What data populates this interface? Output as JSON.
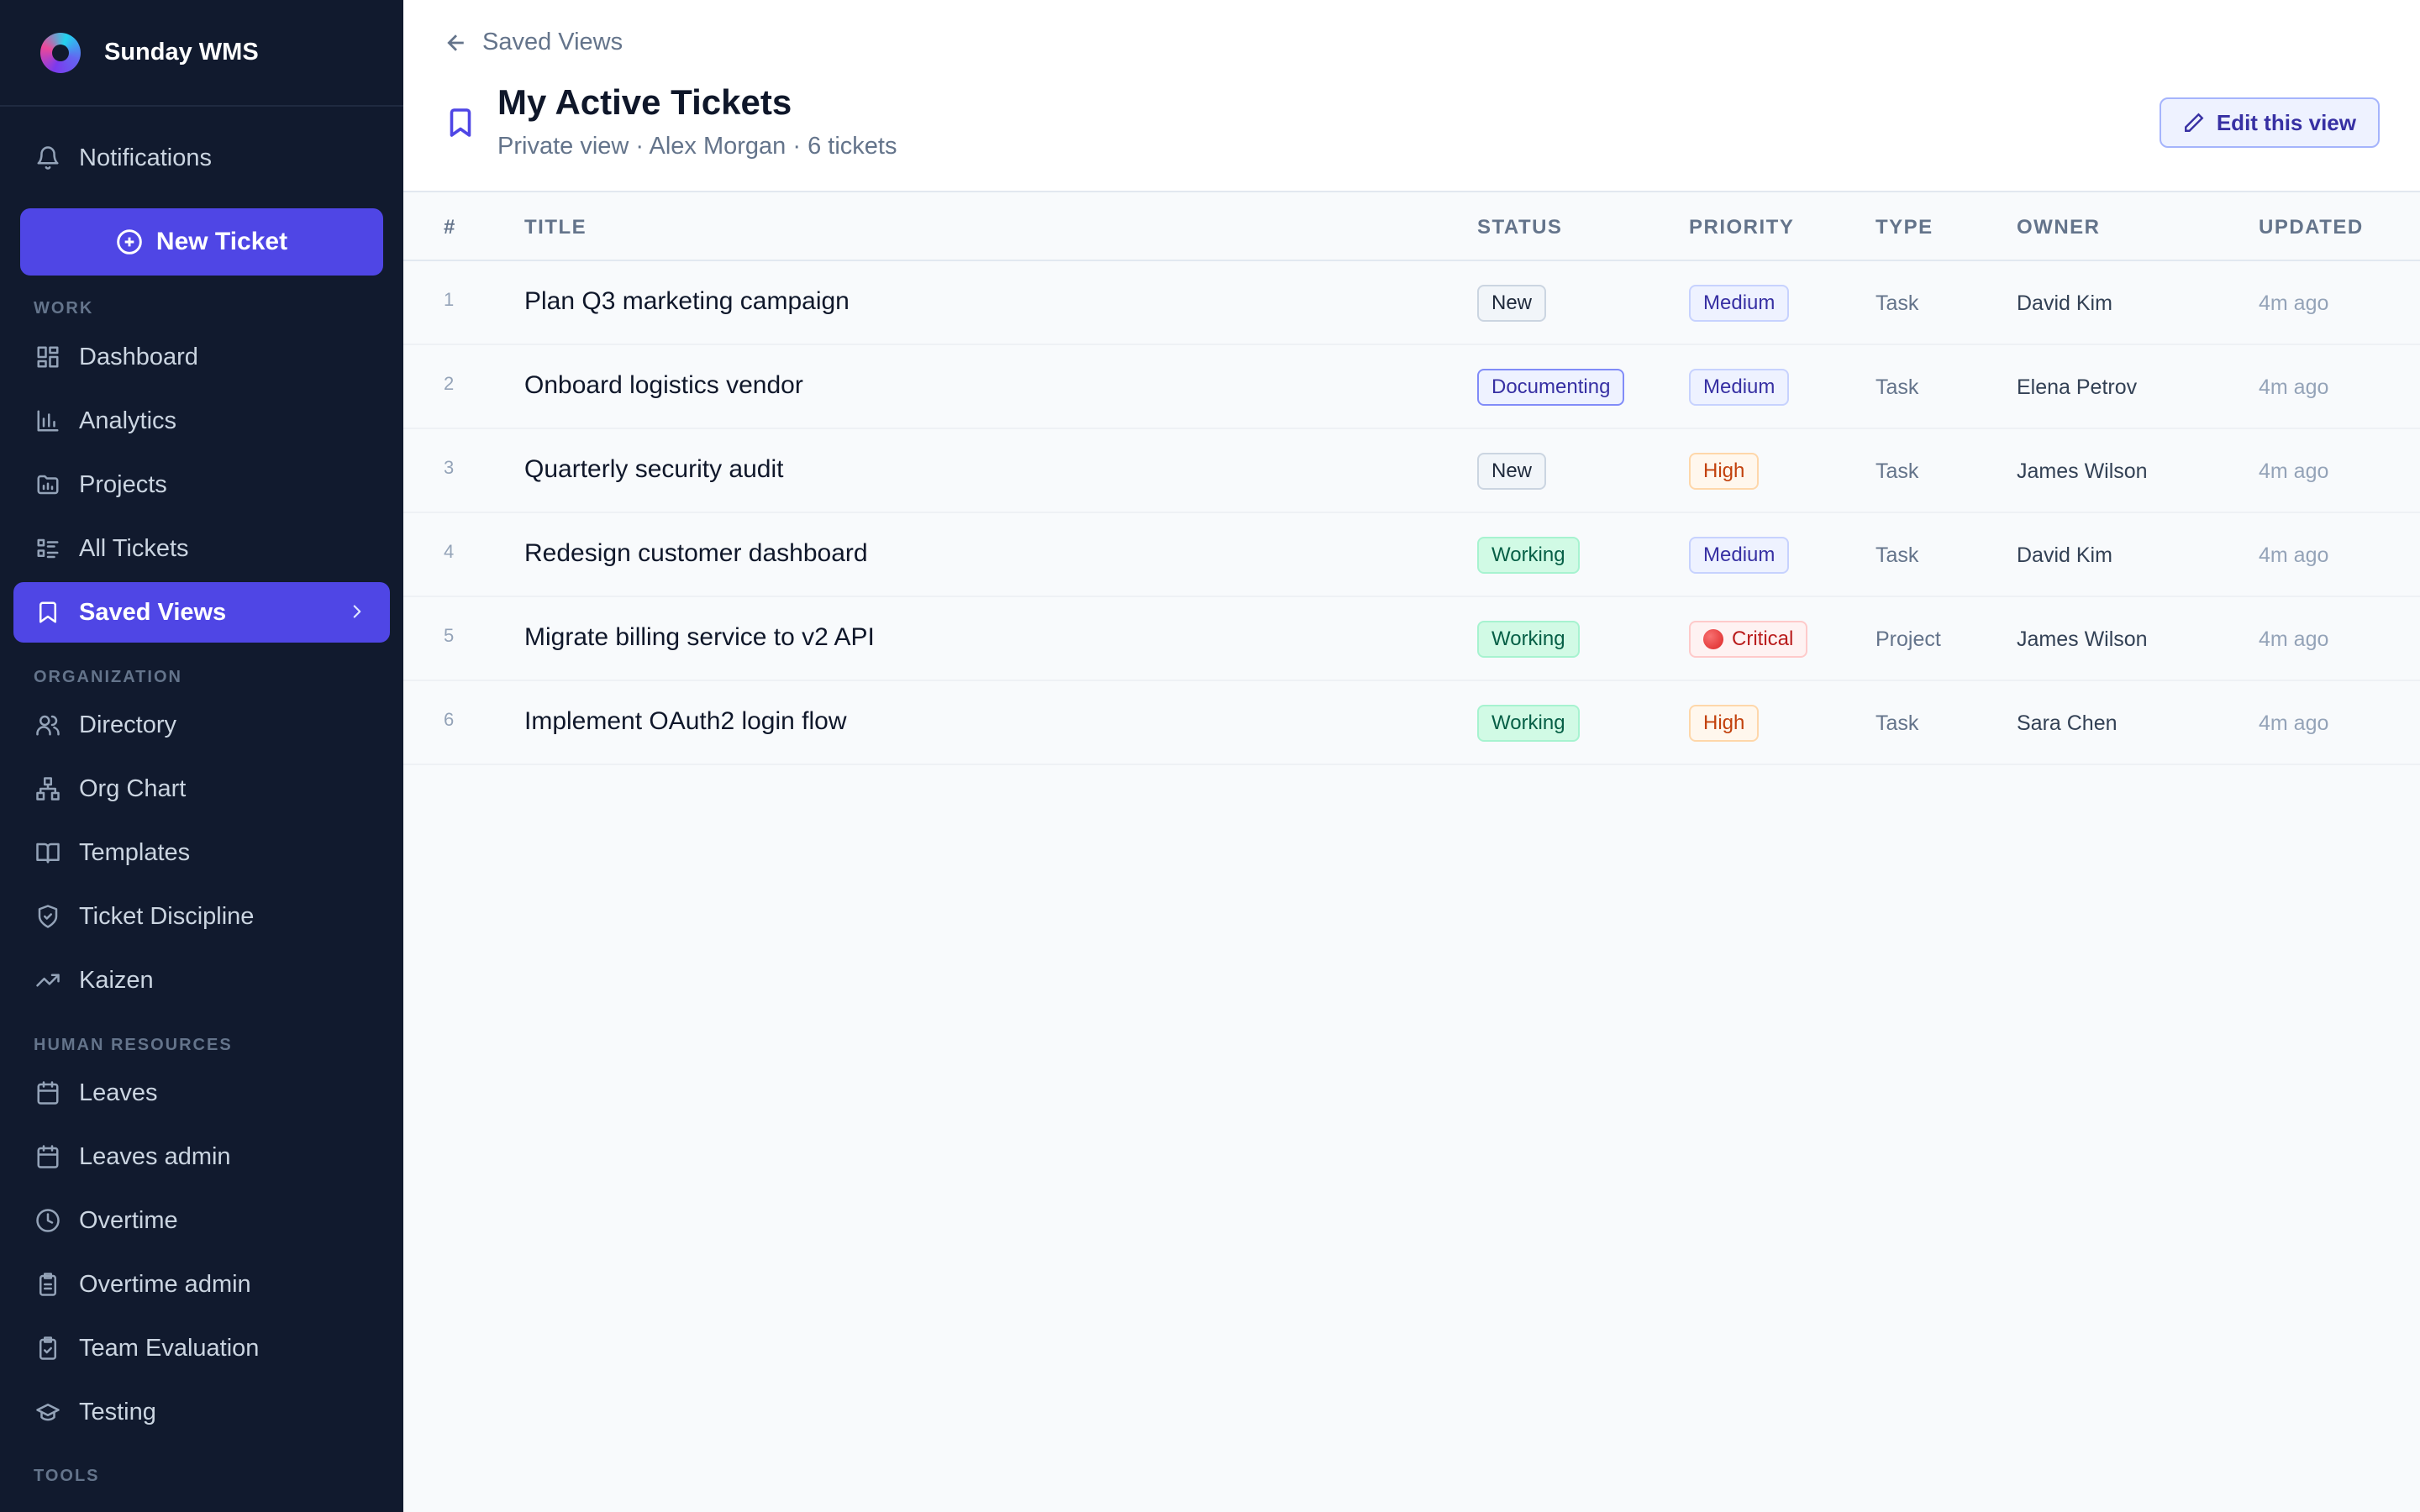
{
  "app": {
    "name": "Sunday WMS"
  },
  "sidebar": {
    "notifications": "Notifications",
    "new_ticket": "New Ticket",
    "sections": {
      "work": "WORK",
      "organization": "ORGANIZATION",
      "human_resources": "HUMAN RESOURCES",
      "tools": "TOOLS"
    },
    "work_items": [
      {
        "label": "Dashboard",
        "icon": "dashboard-icon"
      },
      {
        "label": "Analytics",
        "icon": "bar-chart-icon"
      },
      {
        "label": "Projects",
        "icon": "folder-icon"
      },
      {
        "label": "All Tickets",
        "icon": "list-icon"
      },
      {
        "label": "Saved Views",
        "icon": "bookmark-icon",
        "active": true
      }
    ],
    "organization_items": [
      {
        "label": "Directory",
        "icon": "users-icon"
      },
      {
        "label": "Org Chart",
        "icon": "org-chart-icon"
      },
      {
        "label": "Templates",
        "icon": "book-icon"
      },
      {
        "label": "Ticket Discipline",
        "icon": "shield-icon"
      },
      {
        "label": "Kaizen",
        "icon": "trending-up-icon"
      }
    ],
    "hr_items": [
      {
        "label": "Leaves",
        "icon": "calendar-icon"
      },
      {
        "label": "Leaves admin",
        "icon": "calendar-icon"
      },
      {
        "label": "Overtime",
        "icon": "clock-icon"
      },
      {
        "label": "Overtime admin",
        "icon": "clipboard-icon"
      },
      {
        "label": "Team Evaluation",
        "icon": "clipboard-check-icon"
      },
      {
        "label": "Testing",
        "icon": "graduation-cap-icon"
      }
    ]
  },
  "header": {
    "back_label": "Saved Views",
    "title": "My Active Tickets",
    "subtitle": "Private view · Alex Morgan · 6 tickets",
    "edit_button": "Edit this view"
  },
  "table": {
    "columns": [
      "#",
      "TITLE",
      "STATUS",
      "PRIORITY",
      "TYPE",
      "OWNER",
      "UPDATED"
    ],
    "rows": [
      {
        "num": "1",
        "title": "Plan Q3 marketing campaign",
        "status": "New",
        "priority": "Medium",
        "type": "Task",
        "owner": "David Kim",
        "updated": "4m ago"
      },
      {
        "num": "2",
        "title": "Onboard logistics vendor",
        "status": "Documenting",
        "priority": "Medium",
        "type": "Task",
        "owner": "Elena Petrov",
        "updated": "4m ago"
      },
      {
        "num": "3",
        "title": "Quarterly security audit",
        "status": "New",
        "priority": "High",
        "type": "Task",
        "owner": "James Wilson",
        "updated": "4m ago"
      },
      {
        "num": "4",
        "title": "Redesign customer dashboard",
        "status": "Working",
        "priority": "Medium",
        "type": "Task",
        "owner": "David Kim",
        "updated": "4m ago"
      },
      {
        "num": "5",
        "title": "Migrate billing service to v2 API",
        "status": "Working",
        "priority": "Critical",
        "type": "Project",
        "owner": "James Wilson",
        "updated": "4m ago"
      },
      {
        "num": "6",
        "title": "Implement OAuth2 login flow",
        "status": "Working",
        "priority": "High",
        "type": "Task",
        "owner": "Sara Chen",
        "updated": "4m ago"
      }
    ]
  },
  "colors": {
    "sidebar_bg": "#111a2e",
    "accent": "#4f46e5",
    "page_bg": "#f8fafc"
  }
}
